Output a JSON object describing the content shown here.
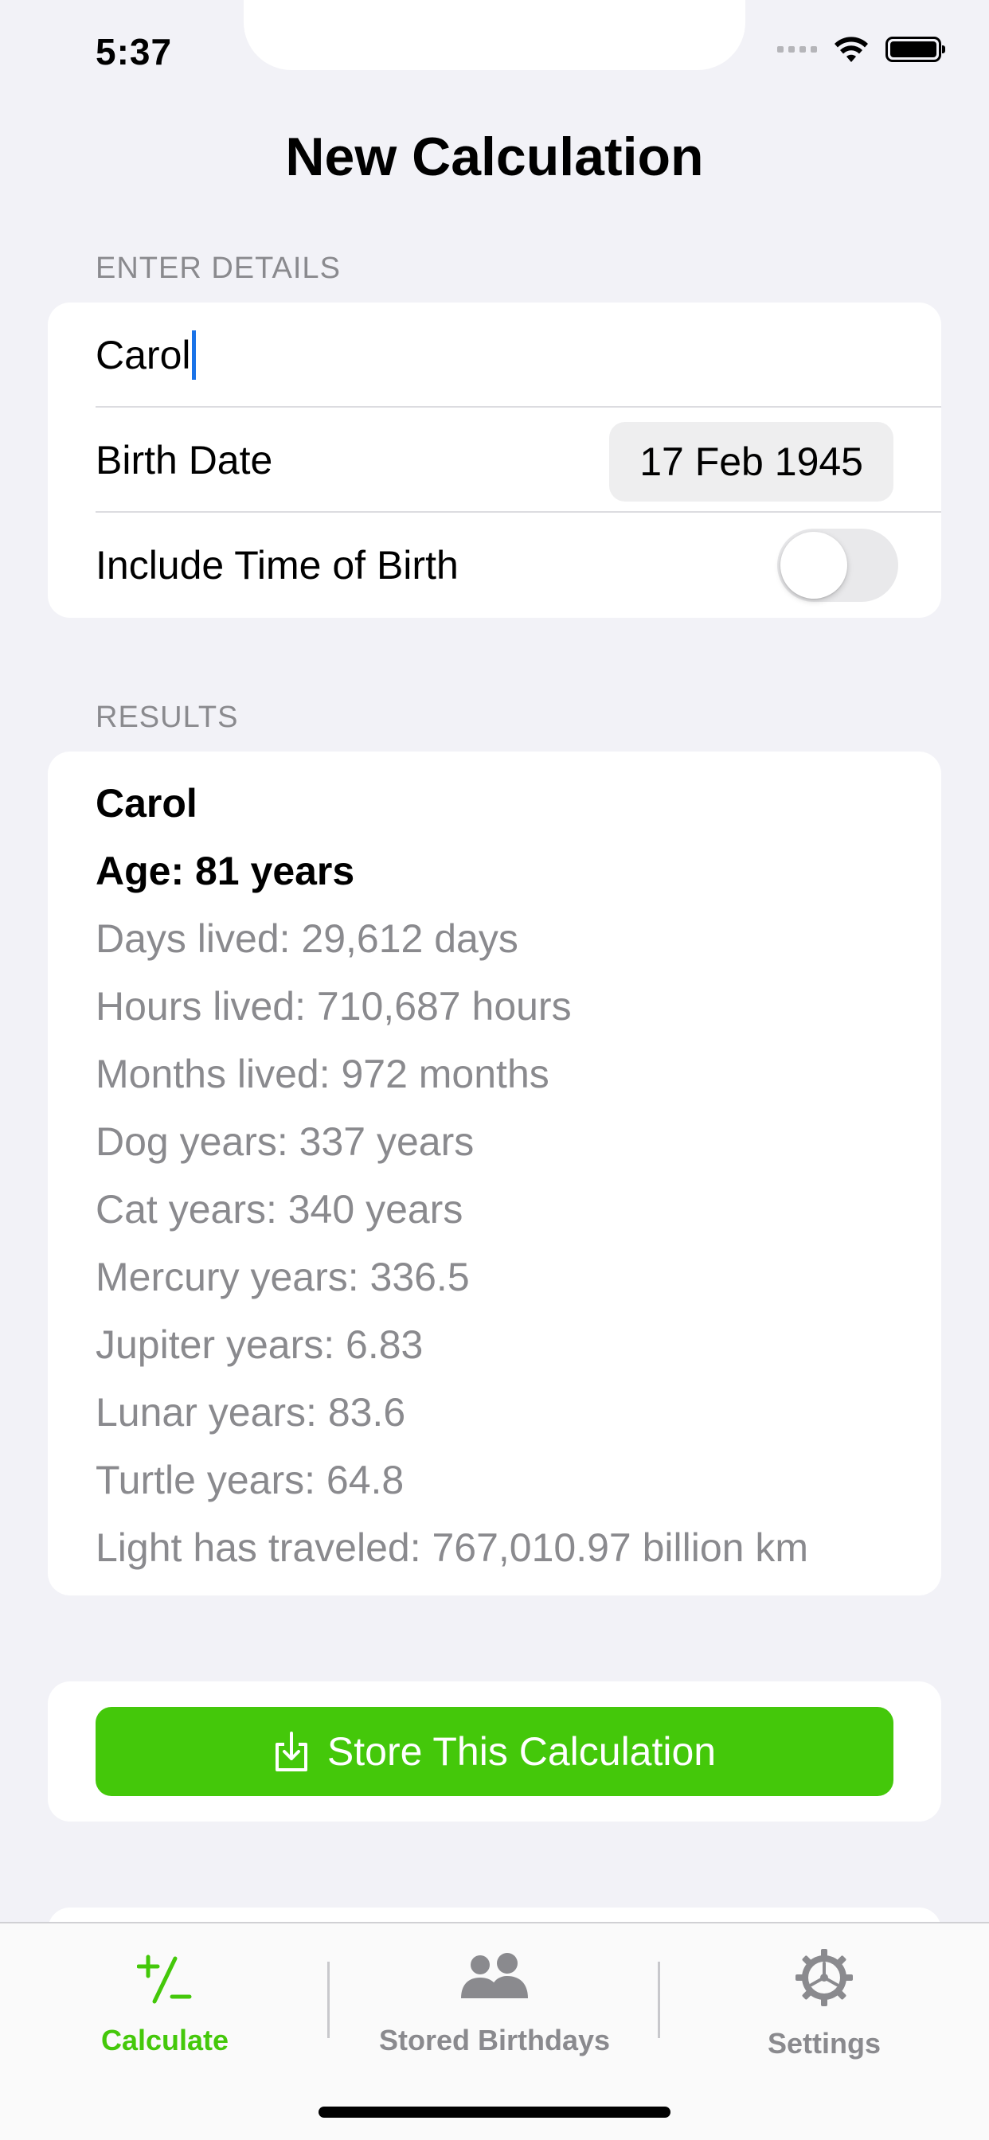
{
  "status_bar": {
    "time": "5:37"
  },
  "nav": {
    "title": "New Calculation"
  },
  "enter_details": {
    "header": "ENTER DETAILS",
    "name_value": "Carol",
    "birth_date_label": "Birth Date",
    "birth_date_value": "17 Feb 1945",
    "time_of_birth_label": "Include Time of Birth",
    "time_of_birth_on": false
  },
  "results": {
    "header": "RESULTS",
    "name": "Carol",
    "age": "Age: 81 years",
    "lines": [
      "Days lived: 29,612 days",
      "Hours lived: 710,687 hours",
      "Months lived: 972 months",
      "Dog years: 337 years",
      "Cat years: 340 years",
      "Mercury years: 336.5",
      "Jupiter years: 6.83",
      "Lunar years: 83.6",
      "Turtle years: 64.8",
      "Light has traveled: 767,010.97 billion km"
    ]
  },
  "actions": {
    "store_label": "Store This Calculation",
    "store_icon": "square-and-arrow-down-icon"
  },
  "tabbar": {
    "tabs": [
      {
        "label": "Calculate",
        "icon": "plus-minus-icon",
        "active": true
      },
      {
        "label": "Stored Birthdays",
        "icon": "people-icon",
        "active": false
      },
      {
        "label": "Settings",
        "icon": "gear-icon",
        "active": false
      }
    ]
  },
  "colors": {
    "accent": "#44c80a",
    "background": "#f2f2f7",
    "secondary_text": "#8a8a8e",
    "caret": "#1a73e8"
  }
}
